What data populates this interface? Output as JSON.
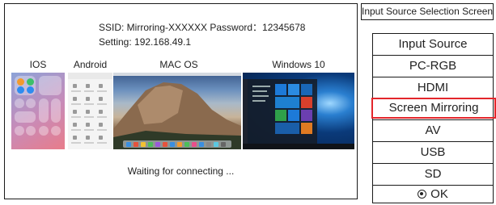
{
  "screen": {
    "ssid_line": "SSID: Mirroring-XXXXXX Password：12345678",
    "setting_line": "Setting: 192.168.49.1",
    "os_labels": {
      "ios": "IOS",
      "android": "Android",
      "mac": "MAC OS",
      "windows": "Windows 10"
    },
    "status": "Waiting for connecting ..."
  },
  "menu": {
    "title": "Input Source Selection Screen",
    "items": [
      {
        "label": "Input Source"
      },
      {
        "label": "PC-RGB"
      },
      {
        "label": "HDMI"
      },
      {
        "label": "Screen Mirroring",
        "selected": true
      },
      {
        "label": "AV"
      },
      {
        "label": "USB"
      },
      {
        "label": "SD"
      }
    ],
    "ok_label": "OK",
    "ok_icon": "radio-dot-icon",
    "highlight_color": "#e3262b"
  }
}
